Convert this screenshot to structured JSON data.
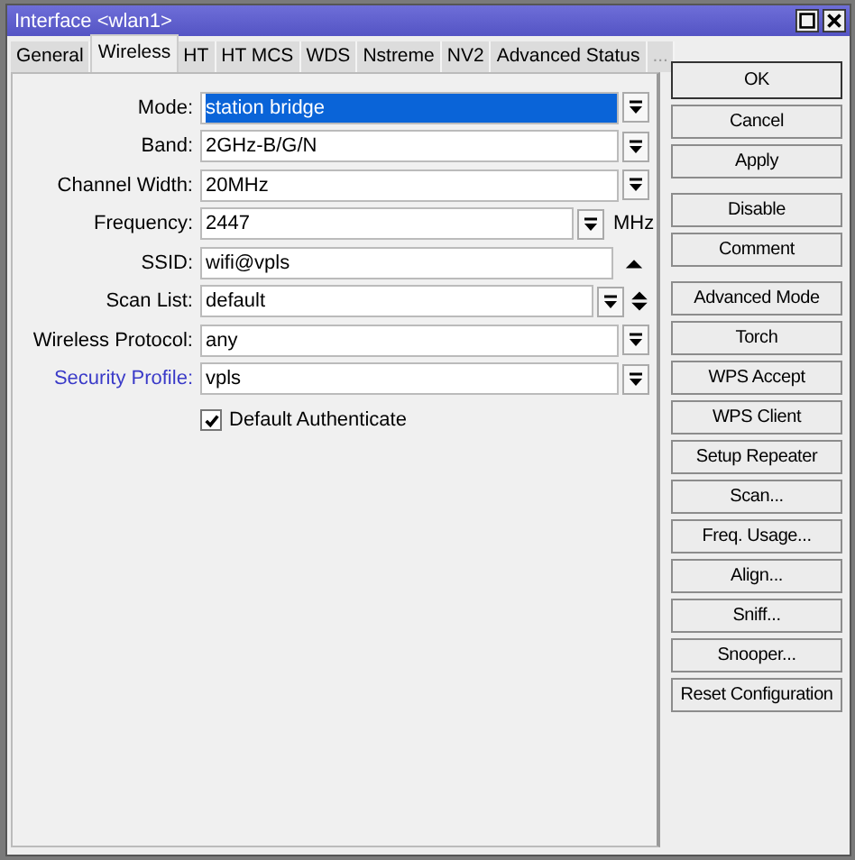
{
  "window": {
    "title": "Interface <wlan1>"
  },
  "tabs": [
    {
      "label": "General",
      "selected": false,
      "disabled": false
    },
    {
      "label": "Wireless",
      "selected": true,
      "disabled": false
    },
    {
      "label": "HT",
      "selected": false,
      "disabled": false
    },
    {
      "label": "HT MCS",
      "selected": false,
      "disabled": false
    },
    {
      "label": "WDS",
      "selected": false,
      "disabled": false
    },
    {
      "label": "Nstreme",
      "selected": false,
      "disabled": false
    },
    {
      "label": "NV2",
      "selected": false,
      "disabled": false
    },
    {
      "label": "Advanced Status",
      "selected": false,
      "disabled": false
    },
    {
      "label": "...",
      "selected": false,
      "disabled": true
    }
  ],
  "fields": [
    {
      "label": "Mode:",
      "value": "station bridge",
      "highlighted": true,
      "link": false,
      "controls": [
        {
          "kind": "dropdown"
        }
      ]
    },
    {
      "label": "Band:",
      "value": "2GHz-B/G/N",
      "highlighted": false,
      "link": false,
      "controls": [
        {
          "kind": "dropdown"
        }
      ]
    },
    {
      "label": "Channel Width:",
      "value": "20MHz",
      "highlighted": false,
      "link": false,
      "controls": [
        {
          "kind": "dropdown"
        }
      ]
    },
    {
      "label": "Frequency:",
      "value": "2447",
      "highlighted": false,
      "link": false,
      "controls": [
        {
          "kind": "dropdown"
        }
      ],
      "unit": "MHz"
    },
    {
      "label": "SSID:",
      "value": "wifi@vpls",
      "highlighted": false,
      "link": false,
      "controls": [
        {
          "kind": "collapse"
        }
      ]
    },
    {
      "label": "Scan List:",
      "value": "default",
      "highlighted": false,
      "link": false,
      "controls": [
        {
          "kind": "dropdown"
        },
        {
          "kind": "updown"
        }
      ]
    },
    {
      "label": "Wireless Protocol:",
      "value": "any",
      "highlighted": false,
      "link": false,
      "controls": [
        {
          "kind": "dropdown"
        }
      ]
    },
    {
      "label": "Security Profile:",
      "value": "vpls",
      "highlighted": false,
      "link": true,
      "controls": [
        {
          "kind": "dropdown"
        }
      ]
    }
  ],
  "checkbox": {
    "label": "Default Authenticate",
    "checked": true
  },
  "button_groups": [
    [
      {
        "label": "OK",
        "default": true
      },
      {
        "label": "Cancel",
        "default": false
      },
      {
        "label": "Apply",
        "default": false
      }
    ],
    [
      {
        "label": "Disable",
        "default": false
      },
      {
        "label": "Comment",
        "default": false
      }
    ],
    [
      {
        "label": "Advanced Mode",
        "default": false
      },
      {
        "label": "Torch",
        "default": false
      },
      {
        "label": "WPS Accept",
        "default": false
      },
      {
        "label": "WPS Client",
        "default": false
      },
      {
        "label": "Setup Repeater",
        "default": false
      },
      {
        "label": "Scan...",
        "default": false
      },
      {
        "label": "Freq. Usage...",
        "default": false
      },
      {
        "label": "Align...",
        "default": false
      },
      {
        "label": "Sniff...",
        "default": false
      },
      {
        "label": "Snooper...",
        "default": false
      },
      {
        "label": "Reset Configuration",
        "default": false
      }
    ]
  ]
}
